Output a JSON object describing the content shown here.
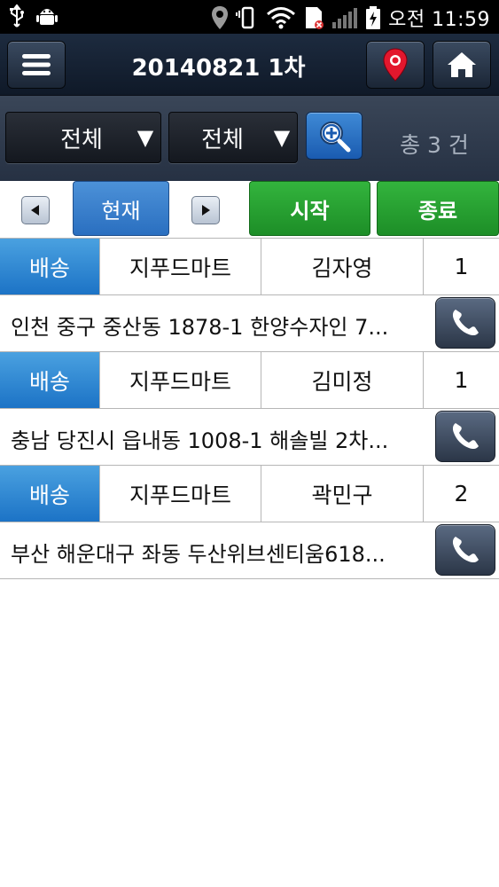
{
  "status_bar": {
    "left_icons": [
      "usb-icon",
      "android-debug-icon"
    ],
    "right_icons": [
      "location-pin-icon",
      "vibrate-icon",
      "wifi-icon",
      "sim-icon",
      "signal-icon",
      "battery-charging-icon"
    ],
    "time": "오전 11:59"
  },
  "header": {
    "title": "20140821 1차",
    "menu_icon": "hamburger-menu-icon",
    "location_icon": "map-pin-icon",
    "home_icon": "home-icon"
  },
  "filters": {
    "first_select_value": "전체",
    "second_select_value": "전체",
    "search_icon": "zoom-search-icon",
    "total_count": "총 3 건"
  },
  "controls": {
    "prev_icon": "triangle-left-icon",
    "current_label": "현재",
    "next_icon": "triangle-right-icon",
    "start_label": "시작",
    "end_label": "종료"
  },
  "orders": [
    {
      "type": "배송",
      "store": "지푸드마트",
      "name": "김자영",
      "count": "1",
      "address": "인천 중구 중산동 1878-1 한양수자인 7..."
    },
    {
      "type": "배송",
      "store": "지푸드마트",
      "name": "김미정",
      "count": "1",
      "address": "충남 당진시 읍내동 1008-1  해솔빌 2차..."
    },
    {
      "type": "배송",
      "store": "지푸드마트",
      "name": "곽민구",
      "count": "2",
      "address": "부산 해운대구 좌동 두산위브센티움618..."
    }
  ],
  "colors": {
    "accent_blue": "#2a6fc0",
    "accent_green": "#1d8e27",
    "header_dark": "#1d2b3f",
    "map_pin_red": "#e3172d"
  }
}
